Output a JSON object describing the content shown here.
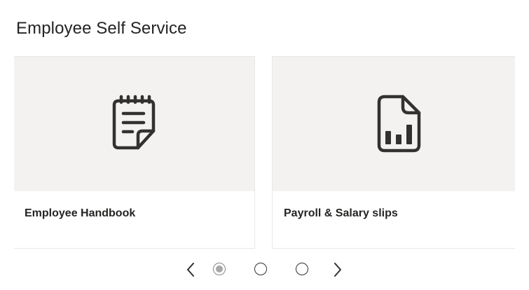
{
  "page": {
    "title": "Employee Self Service"
  },
  "cards": [
    {
      "label": "Employee Handbook",
      "icon": "notepad-icon"
    },
    {
      "label": "Payroll & Salary slips",
      "icon": "report-document-icon"
    }
  ],
  "pager": {
    "previous_icon": "chevron-left-icon",
    "next_icon": "chevron-right-icon",
    "page_count": 3,
    "active_page": 1
  },
  "colors": {
    "text": "#252423",
    "card_media_bg": "#f3f2f1",
    "card_border": "#e8e8e8",
    "icon_stroke": "#323130",
    "dot_active_fill": "#a8a8a8"
  }
}
